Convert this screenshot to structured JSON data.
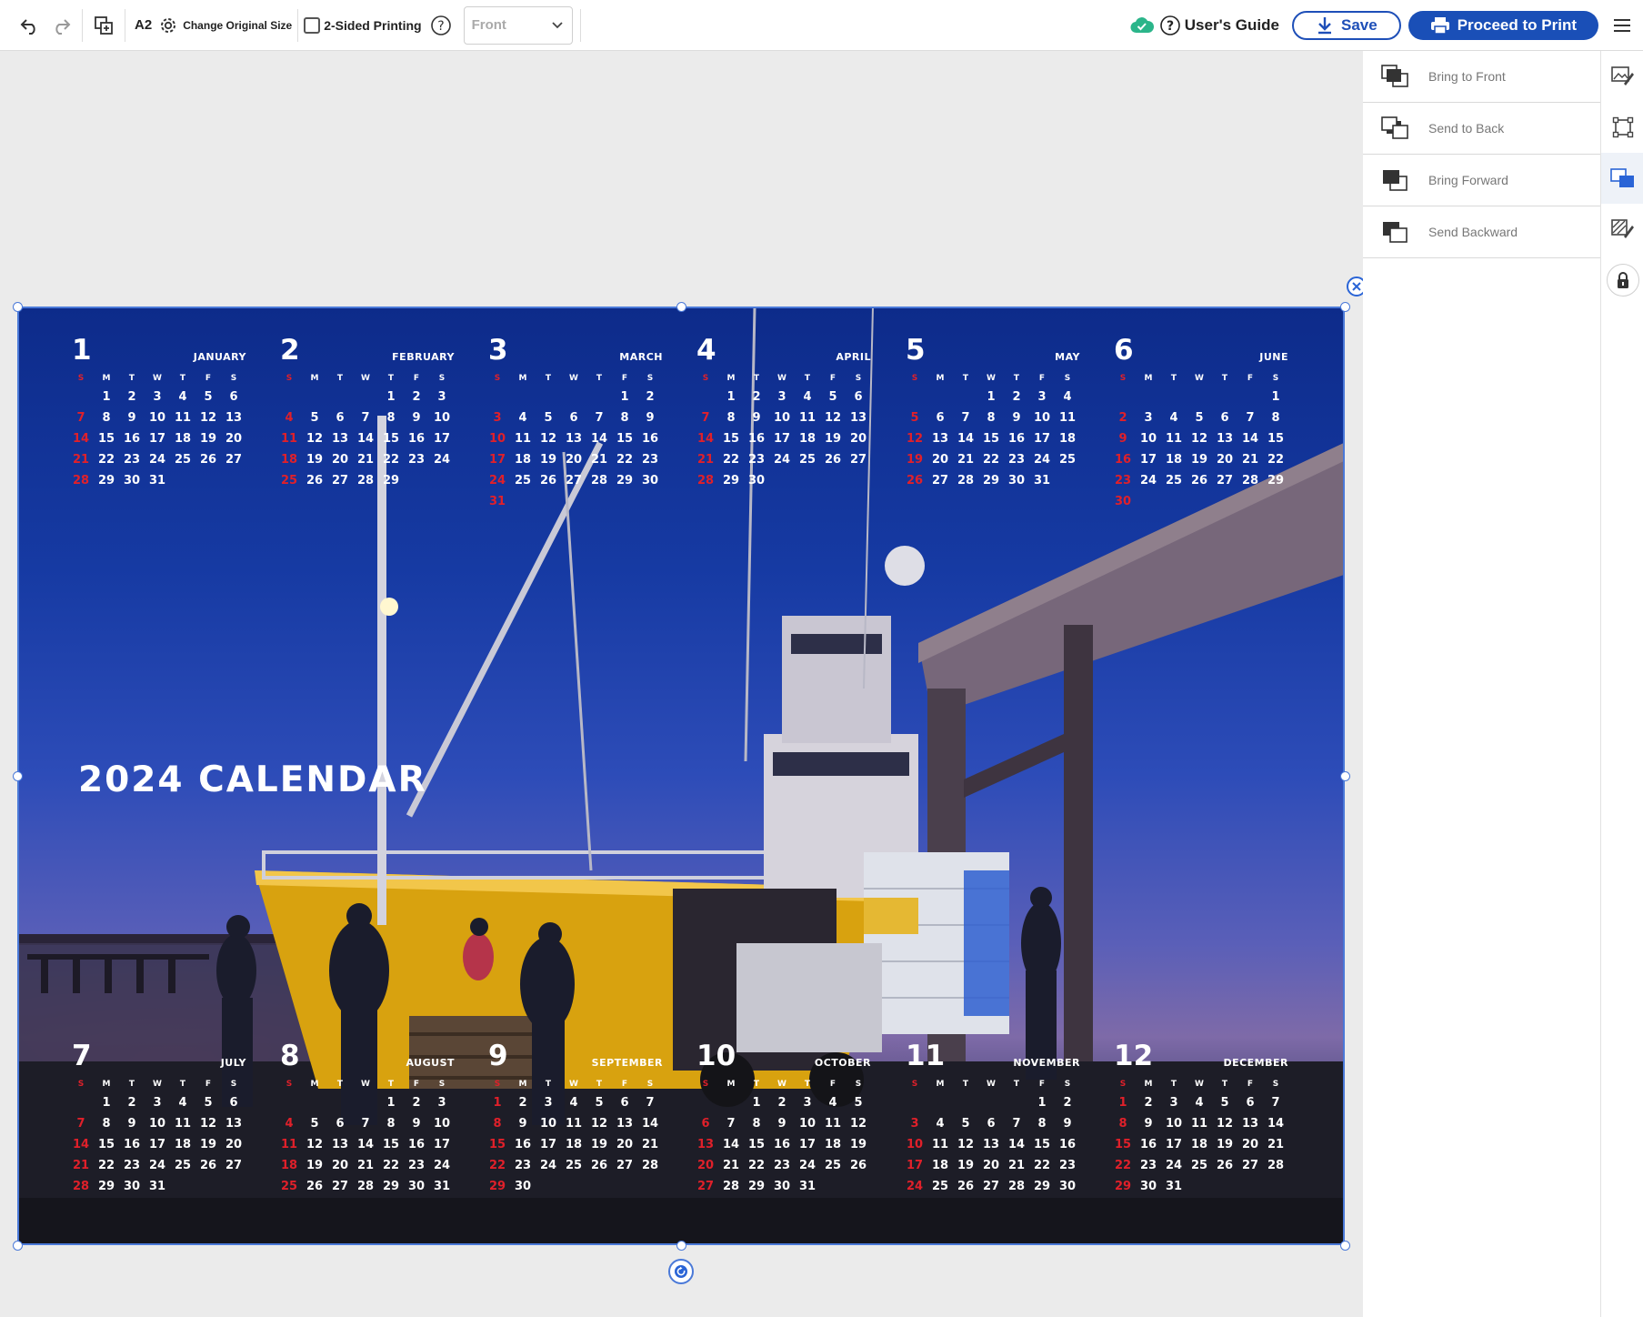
{
  "toolbar": {
    "size": "A2",
    "change_size": "Change Original Size",
    "two_sided": "2-Sided Printing",
    "side_select": "Front",
    "users_guide": "User's Guide",
    "save": "Save",
    "proceed": "Proceed to Print"
  },
  "arrange": {
    "items": [
      "Bring to Front",
      "Send to Back",
      "Bring Forward",
      "Send Backward"
    ]
  },
  "colors": {
    "accent": "#1a4fb7",
    "selection": "#4a79d8",
    "sunday": "#e0202a",
    "cloud_ok": "#2bb58a"
  },
  "calendar": {
    "title": "2024 CALENDAR",
    "dow": [
      "S",
      "M",
      "T",
      "W",
      "T",
      "F",
      "S"
    ],
    "months": [
      {
        "num": "1",
        "name": "JANUARY",
        "start": 1,
        "days": 31
      },
      {
        "num": "2",
        "name": "FEBRUARY",
        "start": 4,
        "days": 29
      },
      {
        "num": "3",
        "name": "MARCH",
        "start": 5,
        "days": 31
      },
      {
        "num": "4",
        "name": "APRIL",
        "start": 1,
        "days": 30
      },
      {
        "num": "5",
        "name": "MAY",
        "start": 3,
        "days": 31
      },
      {
        "num": "6",
        "name": "JUNE",
        "start": 6,
        "days": 30
      },
      {
        "num": "7",
        "name": "JULY",
        "start": 1,
        "days": 31
      },
      {
        "num": "8",
        "name": "AUGUST",
        "start": 4,
        "days": 31
      },
      {
        "num": "9",
        "name": "SEPTEMBER",
        "start": 0,
        "days": 30
      },
      {
        "num": "10",
        "name": "OCTOBER",
        "start": 2,
        "days": 31
      },
      {
        "num": "11",
        "name": "NOVEMBER",
        "start": 5,
        "days": 30
      },
      {
        "num": "12",
        "name": "DECEMBER",
        "start": 0,
        "days": 31
      }
    ]
  }
}
